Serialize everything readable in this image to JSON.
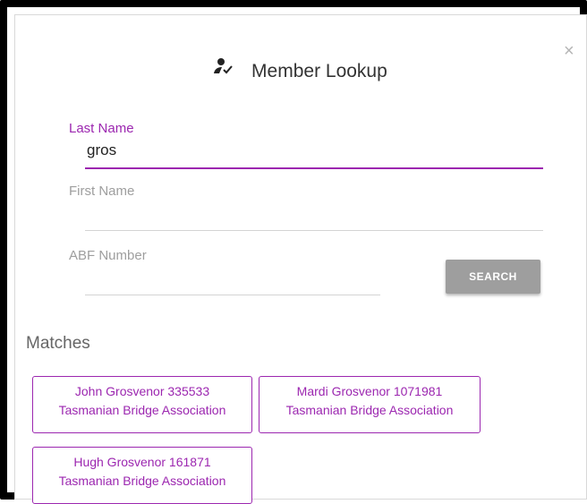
{
  "dialog": {
    "title": "Member Lookup",
    "close_glyph": "×",
    "title_icon": "person-check-icon"
  },
  "form": {
    "last_name": {
      "label": "Last Name",
      "value": "gros"
    },
    "first_name": {
      "label": "First Name",
      "value": ""
    },
    "abf_number": {
      "label": "ABF Number",
      "value": ""
    },
    "search_label": "SEARCH"
  },
  "matches": {
    "heading": "Matches",
    "items": [
      {
        "line1": "John Grosvenor 335533",
        "line2": "Tasmanian Bridge Association"
      },
      {
        "line1": "Mardi Grosvenor 1071981",
        "line2": "Tasmanian Bridge Association"
      },
      {
        "line1": "Hugh Grosvenor 161871",
        "line2": "Tasmanian Bridge Association"
      }
    ]
  },
  "colors": {
    "accent": "#9c27b0",
    "button_bg": "#9e9e9e",
    "underline": "#d4d4d4"
  }
}
